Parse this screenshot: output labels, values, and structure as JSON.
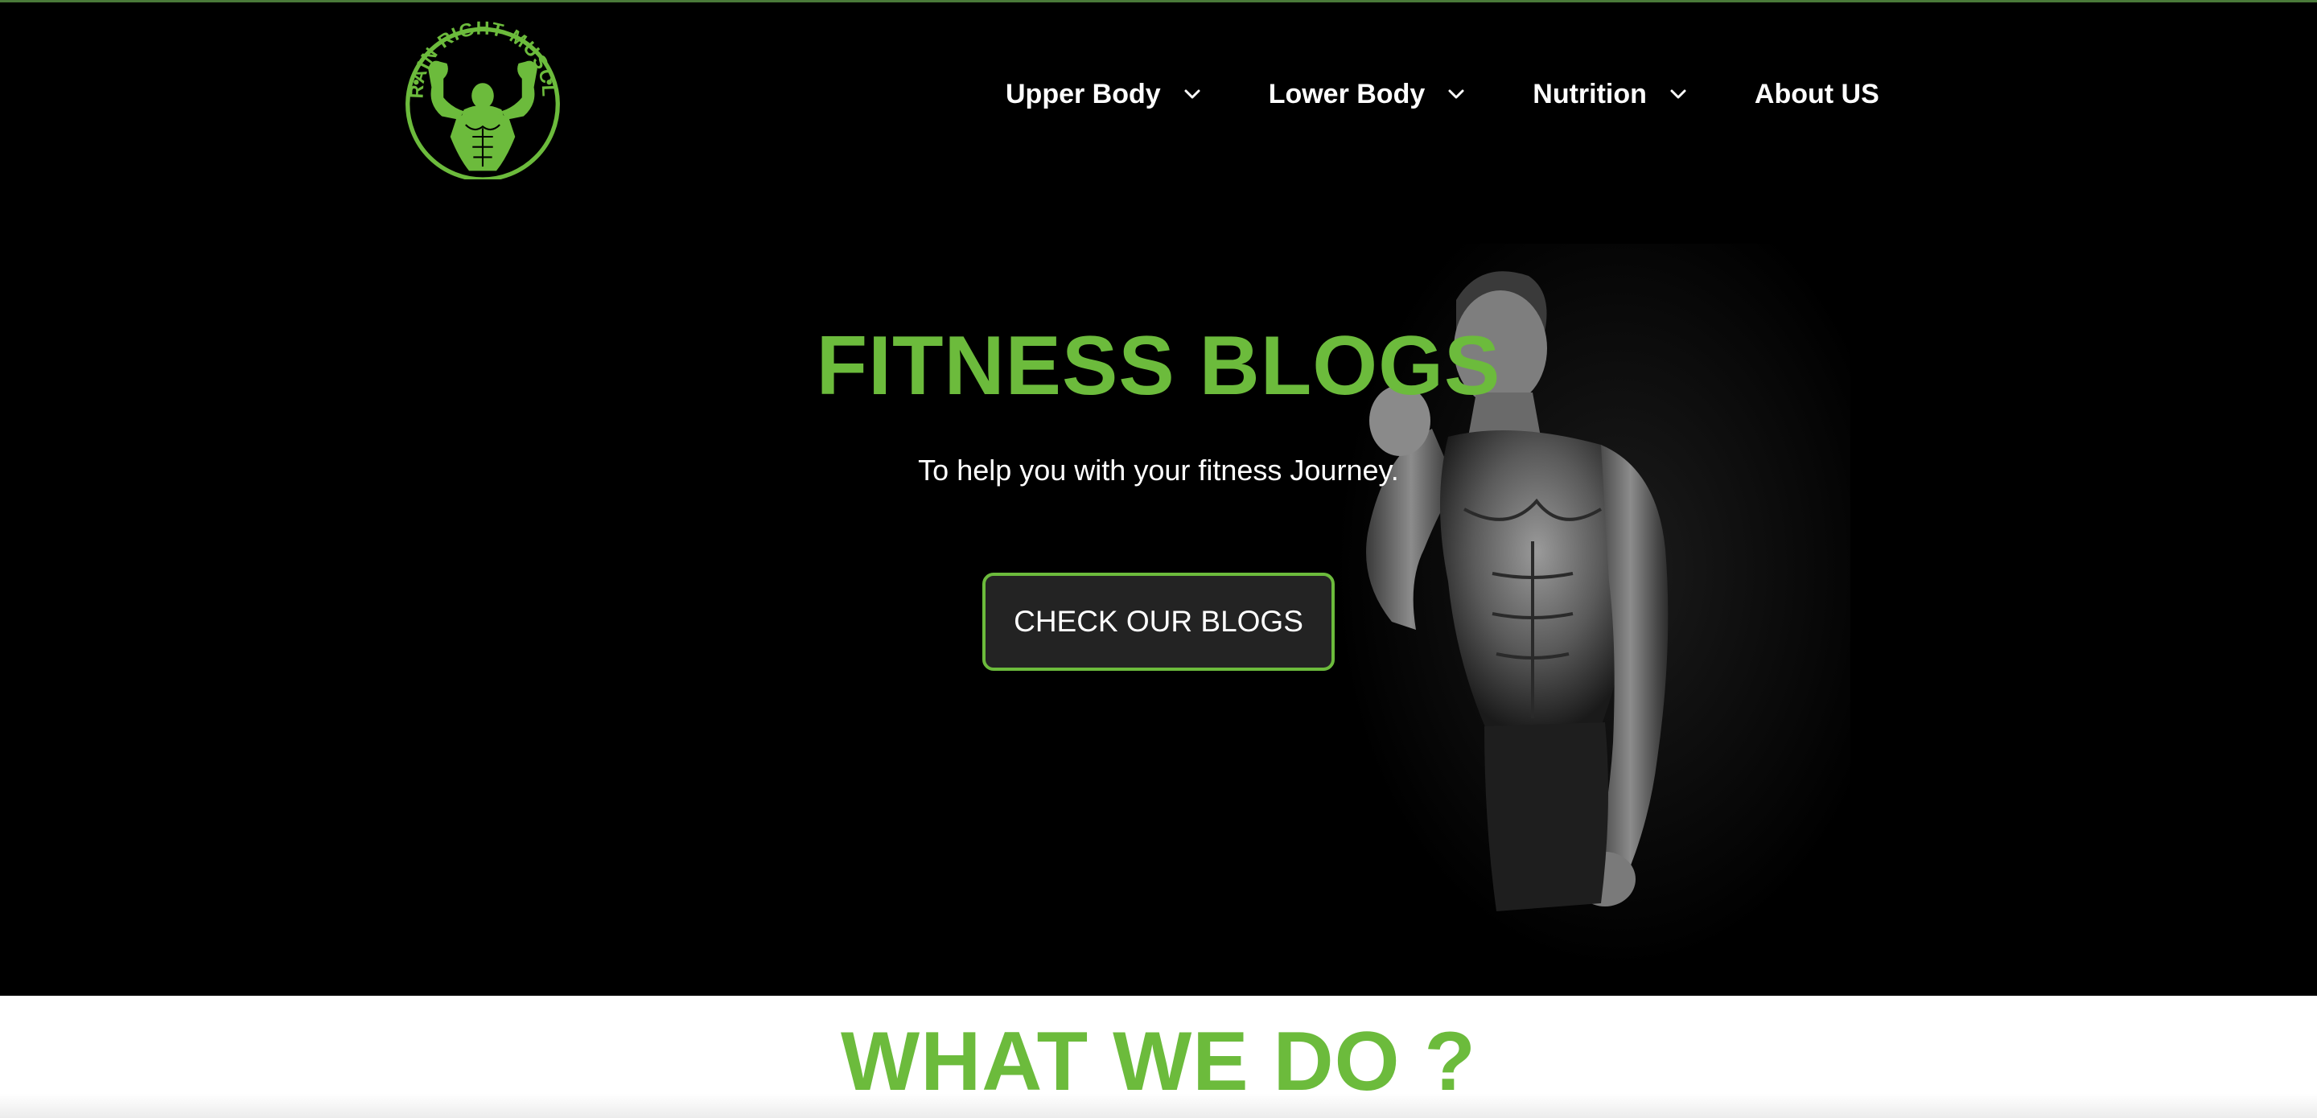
{
  "brand": {
    "logo_text": "TRAIN RIGHT MUSCLE",
    "accent_color": "#6cbb3c",
    "logo_icon": "muscle-man-logo"
  },
  "nav": {
    "items": [
      {
        "label": "Upper Body",
        "has_dropdown": true
      },
      {
        "label": "Lower Body",
        "has_dropdown": true
      },
      {
        "label": "Nutrition",
        "has_dropdown": true
      },
      {
        "label": "About US",
        "has_dropdown": false
      }
    ]
  },
  "hero": {
    "title": "FITNESS BLOGS",
    "subtitle": "To help you with your fitness Journey.",
    "cta_label": "CHECK OUR BLOGS",
    "image_icon": "fitness-model-image"
  },
  "section": {
    "title": "WHAT WE DO ?"
  }
}
